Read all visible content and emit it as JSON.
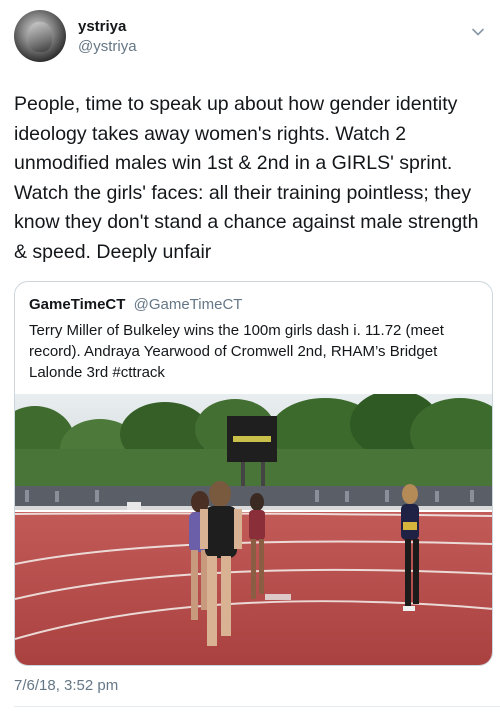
{
  "author": {
    "name": "ystriya",
    "handle": "@ystriya"
  },
  "tweet": {
    "lines": [
      "People, time to speak up about how gender identity",
      "ideology takes away women's rights. Watch 2",
      "unmodified males win 1st & 2nd in a GIRLS' sprint.",
      "Watch the girls' faces: all their training pointless; they",
      "know they don't stand a chance against male strength",
      "& speed. Deeply unfair"
    ],
    "timestamp": "7/6/18, 3:52 pm"
  },
  "quoted": {
    "name": "GameTimeCT",
    "handle": "@GameTimeCT",
    "lines": [
      "Terry Miller of Bulkeley wins the 100m girls dash i. 11.72 (meet",
      "record). Andraya Yearwood of Cromwell 2nd, RHAM’s Bridget",
      "Lalonde 3rd #cttrack"
    ]
  },
  "icons": {
    "menu": "chevron-down-icon",
    "avatar": "profile-photo"
  },
  "colors": {
    "text": "#14171a",
    "secondary": "#657786",
    "border": "#ccd6dd",
    "track": "#b8484a"
  }
}
